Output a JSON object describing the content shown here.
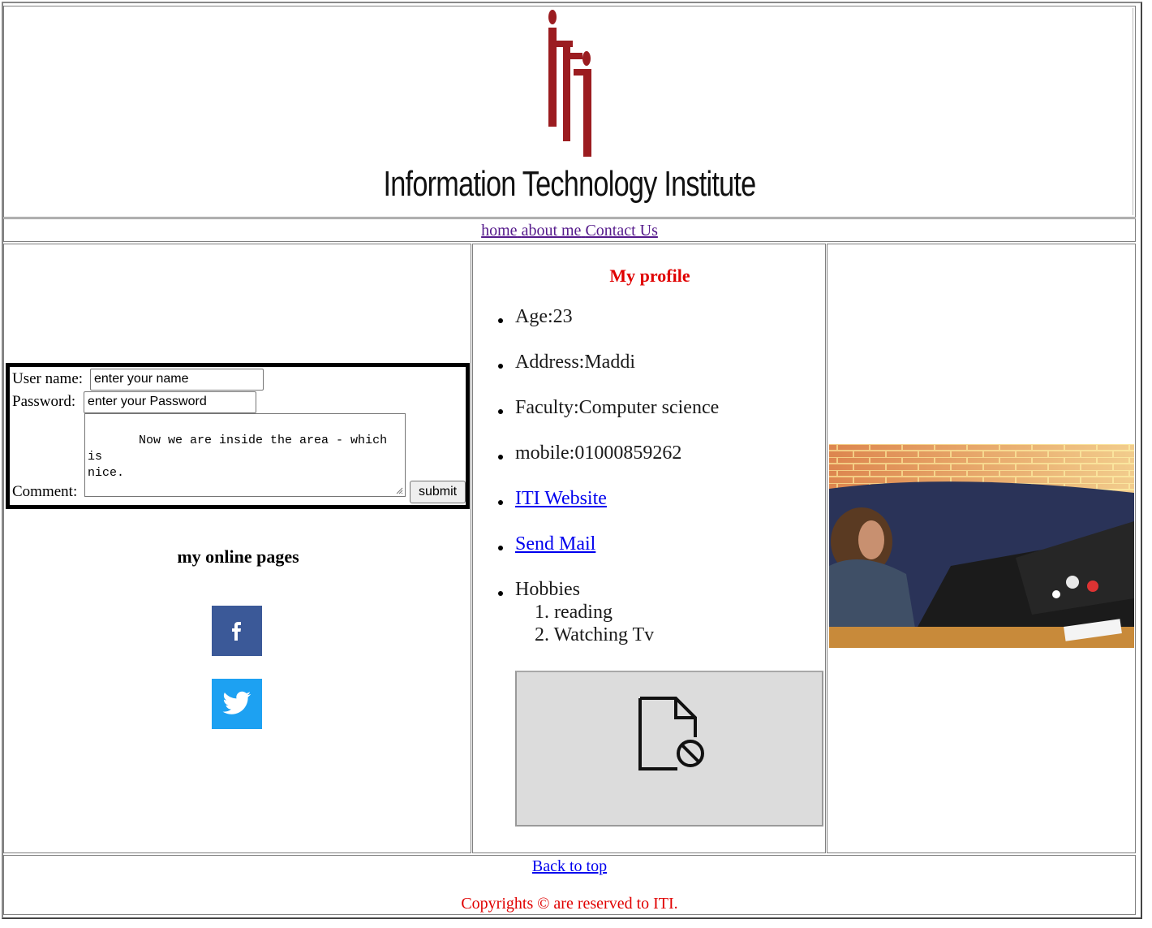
{
  "header": {
    "logo_text": "Information Technology Institute",
    "logo_icon": "iti-logo-icon",
    "brand_color": "#9b1c20"
  },
  "nav": {
    "home": "home",
    "about": "about me",
    "contact": "Contact Us"
  },
  "form": {
    "username_label": "User name:",
    "username_value": "enter your name",
    "password_label": "Password:",
    "password_value": "enter your Password",
    "comment_label": "Comment:",
    "comment_value": " Now we are inside the area - which is\nnice.",
    "submit_label": "submit"
  },
  "online": {
    "title": "my online pages",
    "facebook_icon": "facebook-icon",
    "twitter_icon": "twitter-icon",
    "facebook_color": "#3b5998",
    "twitter_color": "#1da1f2"
  },
  "profile": {
    "title": "My profile",
    "age": "Age:23",
    "address": "Address:Maddi",
    "faculty": "Faculty:Computer science",
    "mobile": "mobile:01000859262",
    "website_link": "ITI Website",
    "mail_link": "Send Mail",
    "hobbies_label": "Hobbies",
    "hobbies": [
      "reading",
      "Watching Tv"
    ],
    "broken_media_icon": "broken-file-icon",
    "title_color": "#e00000"
  },
  "footer": {
    "back_to_top": "Back to top",
    "copyright": "Copyrights © are reserved to ITI.",
    "copyright_color": "#e00000"
  }
}
